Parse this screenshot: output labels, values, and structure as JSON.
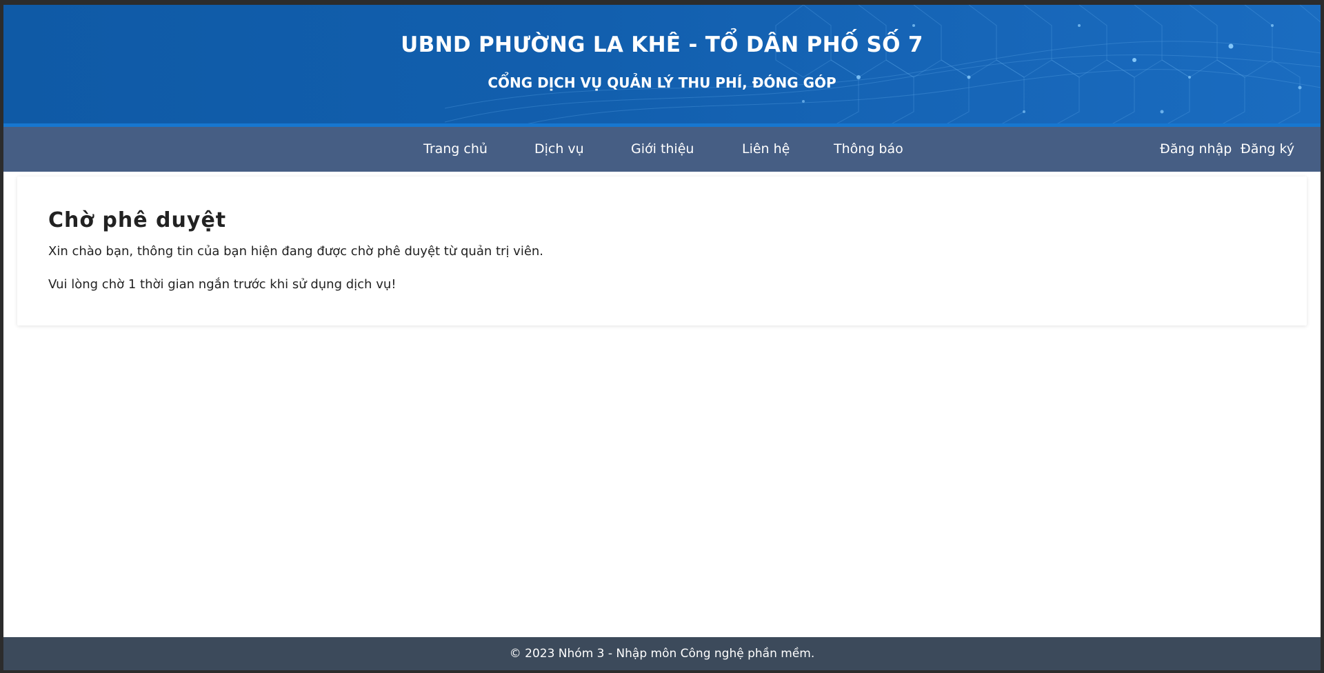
{
  "header": {
    "title": "UBND PHƯỜNG LA KHÊ - TỔ DÂN PHỐ SỐ 7",
    "subtitle": "CỔNG DỊCH VỤ QUẢN LÝ THU PHÍ, ĐÓNG GÓP"
  },
  "nav": {
    "items": [
      {
        "label": "Trang chủ"
      },
      {
        "label": "Dịch vụ"
      },
      {
        "label": "Giới thiệu"
      },
      {
        "label": "Liên hệ"
      },
      {
        "label": "Thông báo"
      }
    ],
    "login": "Đăng nhập",
    "register": "Đăng ký"
  },
  "main": {
    "heading": "Chờ phê duyệt",
    "line1": "Xin chào bạn, thông tin của bạn hiện đang được chờ phê duyệt từ quản trị viên.",
    "line2": "Vui lòng chờ 1 thời gian ngắn trước khi sử dụng dịch vụ!"
  },
  "footer": {
    "text": "© 2023 Nhóm 3 - Nhập môn Công nghệ phần mềm."
  },
  "colors": {
    "banner": "#125fae",
    "navbar": "#465e84",
    "footer": "#3c4a5b"
  }
}
